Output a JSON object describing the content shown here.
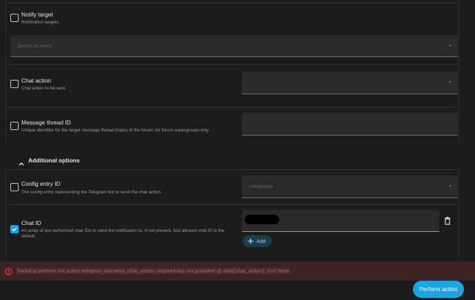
{
  "fields": {
    "notify_target": {
      "title": "Notify target",
      "description": "Notification targets.",
      "placeholder": "Select an entity",
      "checked": false
    },
    "chat_action": {
      "title": "Chat action",
      "description": "Chat action to be sent.",
      "checked": false
    },
    "message_thread_id": {
      "title": "Message thread ID",
      "description": "Unique identifier for the target message thread (topic) of the forum; for forum supergroups only.",
      "checked": false
    },
    "config_entry_id": {
      "title": "Config entry ID",
      "description": "The config entry representing the Telegram bot to send the chat action.",
      "placeholder": "Integration",
      "checked": false
    },
    "chat_id": {
      "title": "Chat ID",
      "description": "An array of pre-authorized chat IDs to send the notification to. If not present, first allowed chat ID is the default.",
      "checked": true,
      "add_label": "Add"
    }
  },
  "additional_options": {
    "label": "Additional options"
  },
  "error": {
    "message": "Failed to perform the action telegram_bot.send_chat_action. required key not provided @ data['chat_action']. Got None"
  },
  "actions": {
    "perform_label": "Perform action"
  },
  "colors": {
    "accent": "#03a9f4",
    "error": "#db4437",
    "background": "#1c1c1c"
  },
  "icons": {
    "collapse": "chevron-up-icon",
    "delete": "trash-icon",
    "add": "plus-icon",
    "error": "alert-circle-icon"
  }
}
